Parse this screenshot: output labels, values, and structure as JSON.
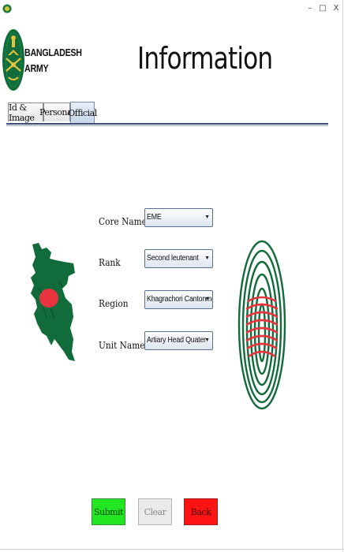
{
  "window": {
    "minimize_glyph": "–",
    "maximize_glyph": "□",
    "close_glyph": "X",
    "app_icon": "circle-logo-icon"
  },
  "header": {
    "logo_line1": "BANGLADESH",
    "logo_line2": "ARMY",
    "title": "Information"
  },
  "tabs": [
    {
      "label": "Id & Image",
      "active": false
    },
    {
      "label": "Personal",
      "active": false
    },
    {
      "label": "Official",
      "active": true
    }
  ],
  "form": {
    "fields": [
      {
        "label": "Core Name",
        "value": "EME"
      },
      {
        "label": "Rank",
        "value": "Second leutenant"
      },
      {
        "label": "Region",
        "value": "Khagrachori Cantonment"
      },
      {
        "label": "Unit Name",
        "value": "Artiary Head Quater"
      }
    ]
  },
  "buttons": {
    "submit": "Submit",
    "clear": "Clear",
    "back": "Back"
  },
  "colors": {
    "submit_bg": "#22e622",
    "back_bg": "#ff1414",
    "flag_green": "#116b3a",
    "flag_red": "#e8343f"
  }
}
